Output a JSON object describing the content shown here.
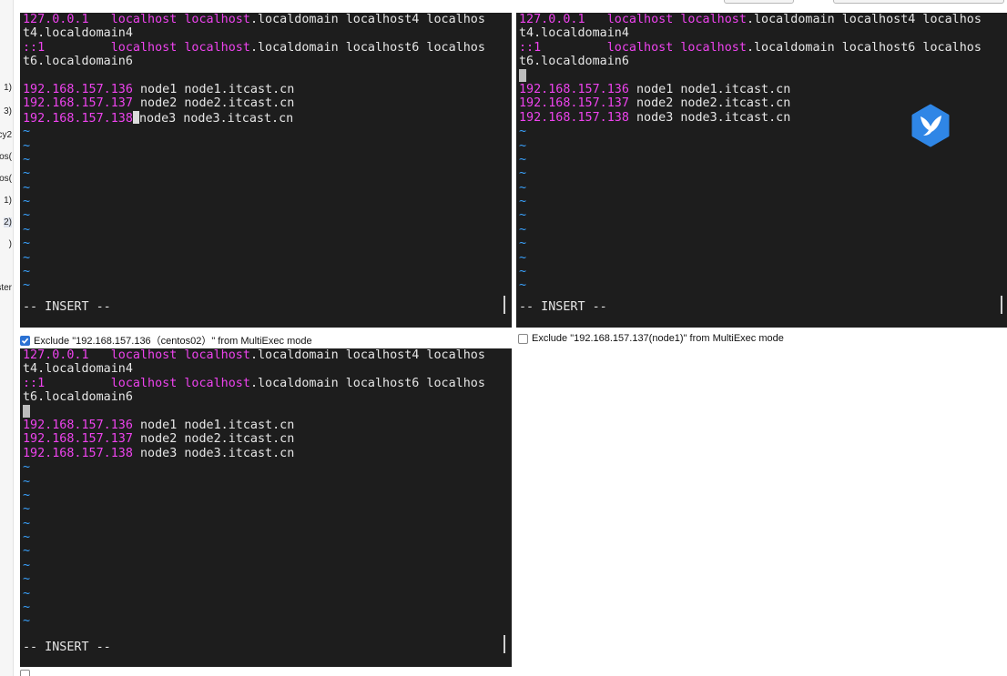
{
  "sidebar": {
    "items": [
      {
        "label": "1)"
      },
      {
        "label": "3)"
      },
      {
        "label": "cy2"
      },
      {
        "label": "tos("
      },
      {
        "label": "tos("
      },
      {
        "label": "1)"
      },
      {
        "label": "2)"
      },
      {
        "label": ")"
      },
      {
        "label": "ster"
      }
    ]
  },
  "hosts": {
    "l1_ip": "127.0.0.1",
    "l1_host": "localhost",
    "l1_host2": "localhost",
    "l1_tail": ".localdomain localhost4 localhos",
    "l2": "t4.localdomain4",
    "l3_ip": "::1",
    "l3_host": "localhost",
    "l3_host2": "localhost",
    "l3_tail": ".localdomain localhost6 localhos",
    "l4": "t6.localdomain6",
    "n1_ip": "192.168.157.136",
    "n1_rest": " node1 node1.itcast.cn",
    "n2_ip": "192.168.157.137",
    "n2_rest": " node2 node2.itcast.cn",
    "n3_ip": "192.168.157.138",
    "n3_rest": " node3 node3.itcast.cn",
    "n3_rest_nospace": "node3 node3.itcast.cn",
    "tilde": "~",
    "status": "-- INSERT --"
  },
  "exclude": {
    "pane1": "Exclude \"192.168.157.136（centos02）\" from MultiExec mode",
    "pane2": "Exclude \"192.168.157.137(node1)\" from MultiExec mode"
  },
  "icons": {
    "app_logo": "bird-logo-icon"
  },
  "colors": {
    "terminal_bg": "#1d1d1d",
    "magenta": "#ee43ee",
    "tilde_blue": "#3aa3ff",
    "logo_blue": "#2f86e6"
  }
}
